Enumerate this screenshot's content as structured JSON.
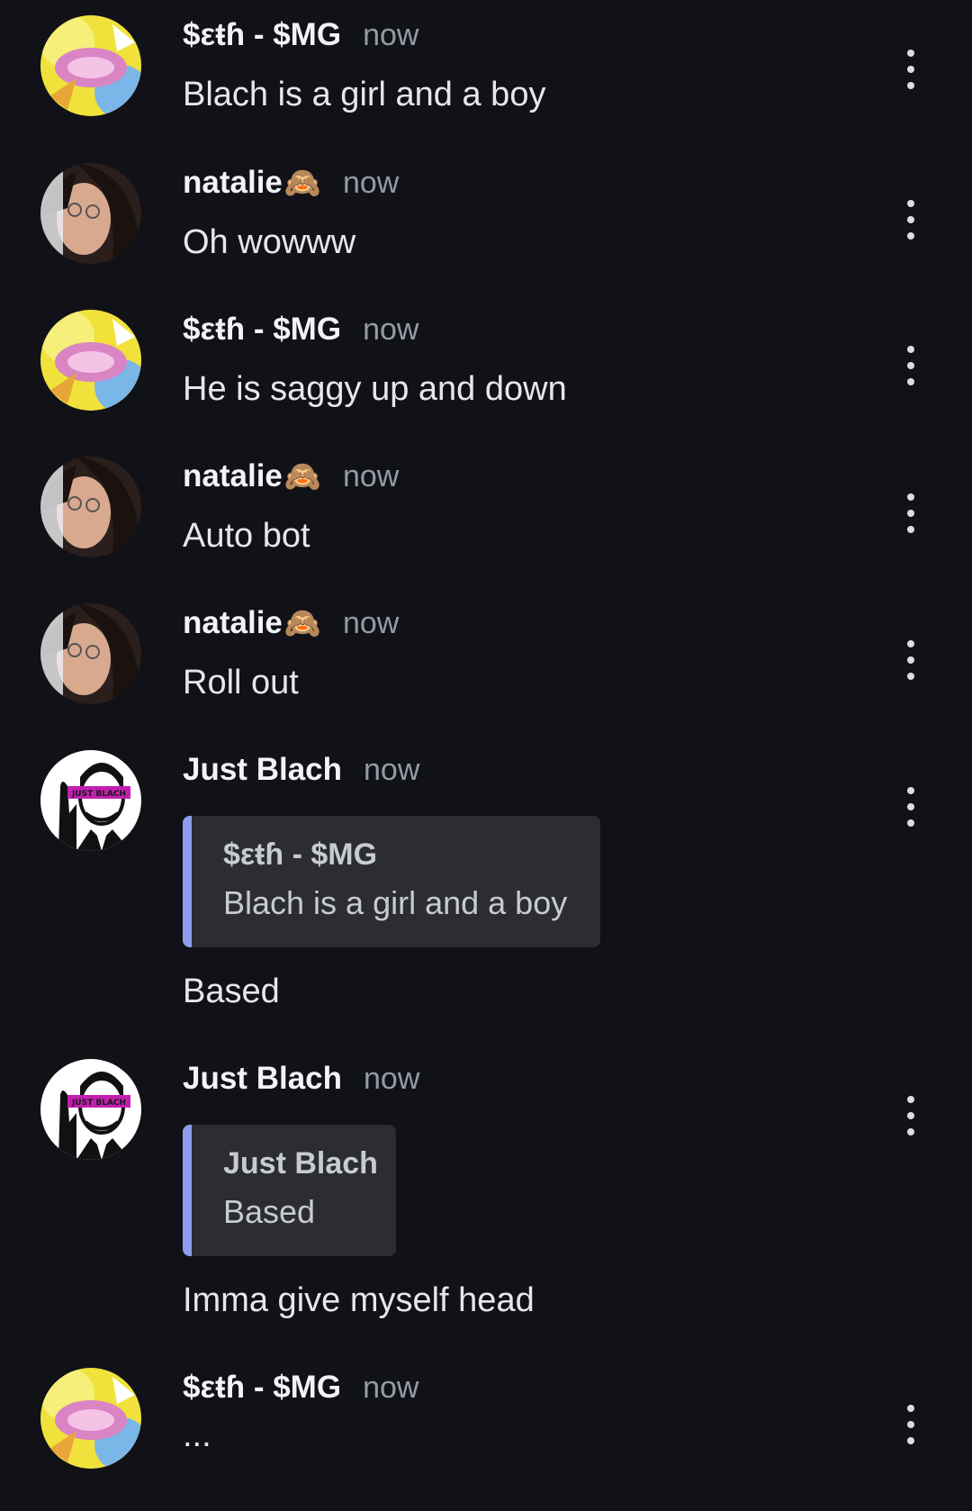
{
  "messages": [
    {
      "author": "$εŧɦ - $MG",
      "emoji": "",
      "time": "now",
      "text": "Blach is a girl and a boy"
    },
    {
      "author": "natalie",
      "emoji": "🙈",
      "time": "now",
      "text": "Oh wowww"
    },
    {
      "author": "$εŧɦ - $MG",
      "emoji": "",
      "time": "now",
      "text": "He is saggy up and down"
    },
    {
      "author": "natalie",
      "emoji": "🙈",
      "time": "now",
      "text": "Auto bot"
    },
    {
      "author": "natalie",
      "emoji": "🙈",
      "time": "now",
      "text": "Roll out"
    },
    {
      "author": "Just Blach",
      "emoji": "",
      "time": "now",
      "reply": {
        "author": "$εŧɦ - $MG",
        "text": "Blach is a girl and a boy"
      },
      "text": "Based"
    },
    {
      "author": "Just Blach",
      "emoji": "",
      "time": "now",
      "reply": {
        "author": "Just Blach",
        "text": "Based"
      },
      "text": "Imma give myself head"
    },
    {
      "author": "$εŧɦ - $MG",
      "emoji": "",
      "time": "now",
      "text": "..."
    }
  ],
  "icons": {
    "more": "more-vertical-icon",
    "avatar_logo_text": "JUST BLACH"
  },
  "colors": {
    "background": "#111218",
    "reply_bar": "#8f9df0",
    "reply_bg": "#2b2d31",
    "timestamp": "#949ba4"
  }
}
